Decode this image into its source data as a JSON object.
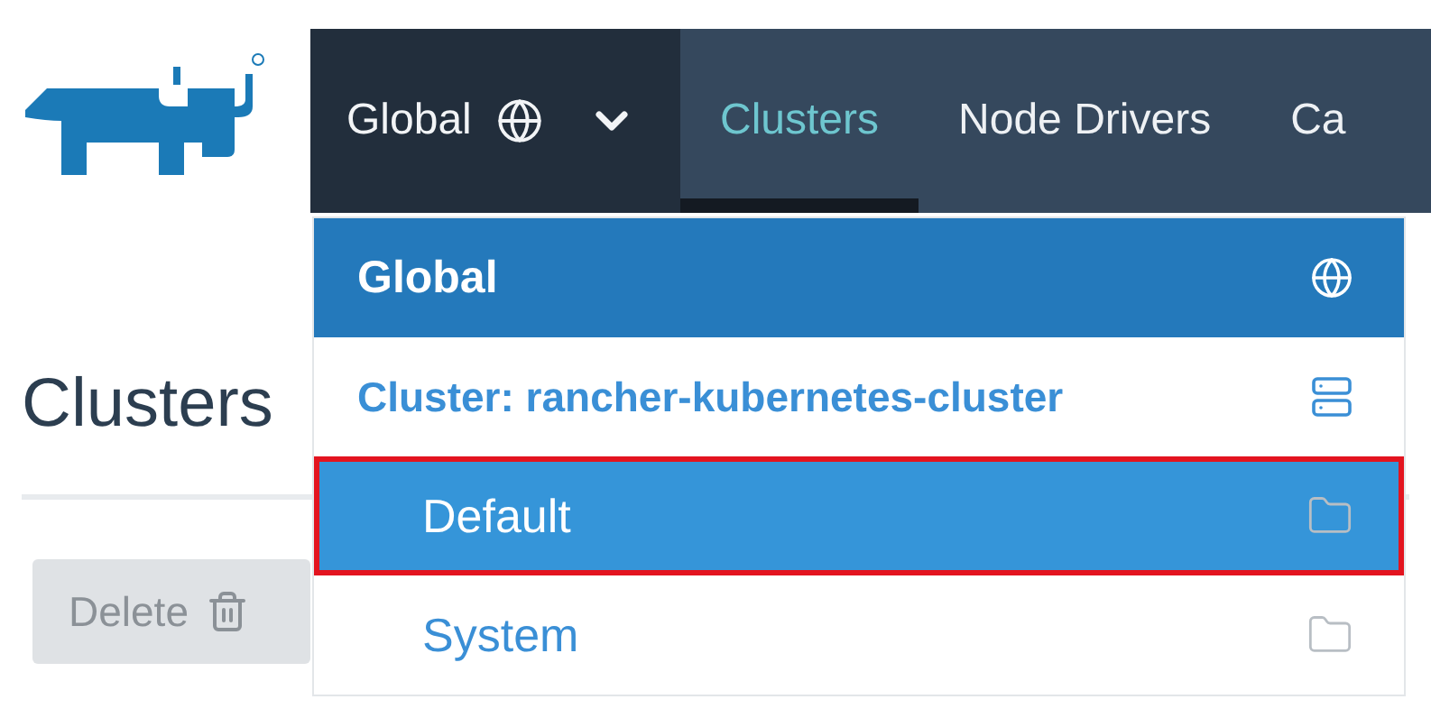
{
  "header": {
    "scope_selector": {
      "label": "Global"
    },
    "nav": [
      {
        "label": "Clusters",
        "selected": true
      },
      {
        "label": "Node Drivers",
        "selected": false
      },
      {
        "label": "Ca",
        "selected": false
      }
    ]
  },
  "page": {
    "title": "Clusters",
    "delete_button": {
      "label": "Delete",
      "disabled": true
    }
  },
  "scope_menu": {
    "items": [
      {
        "kind": "global",
        "label": "Global"
      },
      {
        "kind": "cluster",
        "label": "Cluster: rancher-kubernetes-cluster",
        "children": [
          {
            "label": "Default",
            "selected": true,
            "outlined": true
          },
          {
            "label": "System",
            "selected": false,
            "outlined": false
          }
        ]
      }
    ]
  }
}
